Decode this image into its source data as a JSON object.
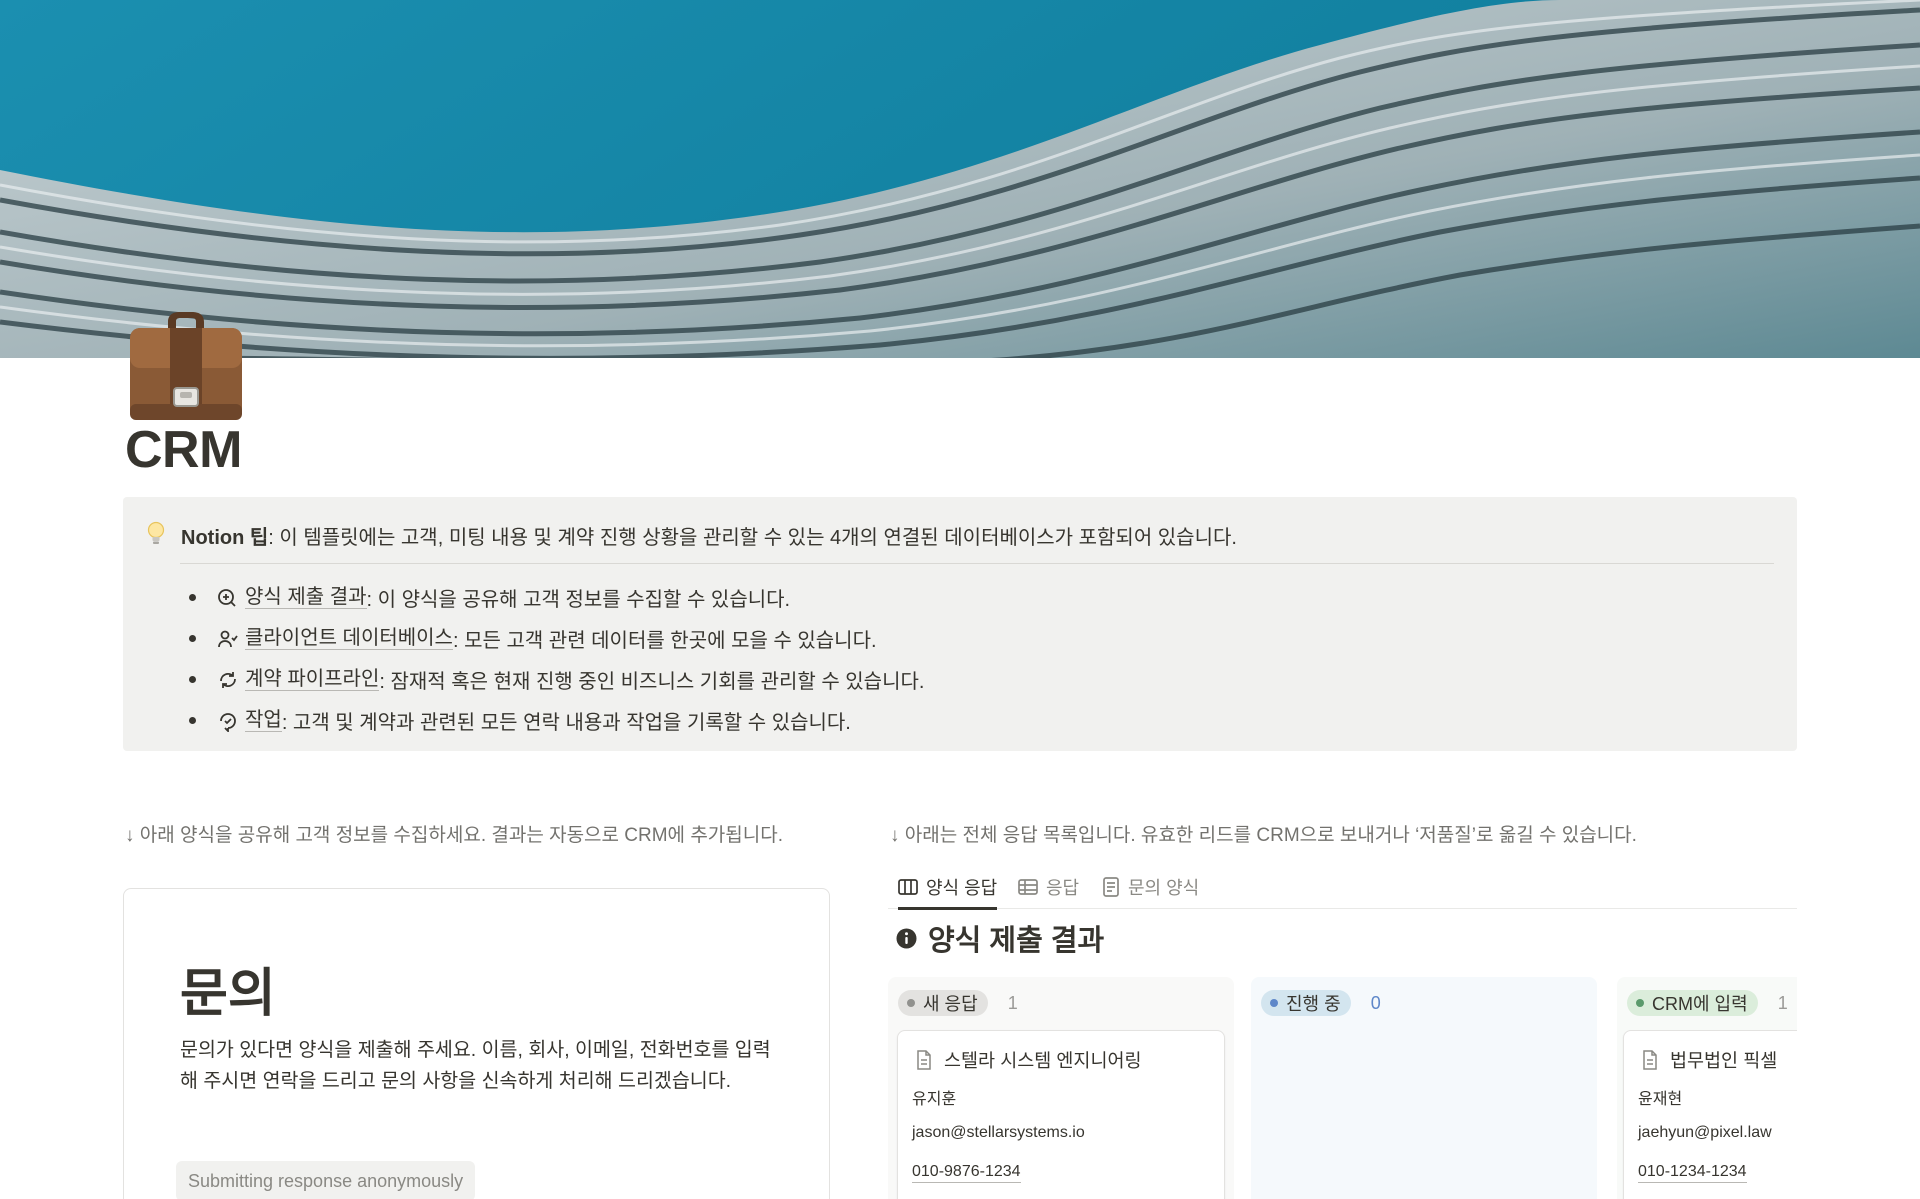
{
  "page": {
    "title": "CRM",
    "cover": "building-facade-cover-image",
    "icon": "briefcase-icon"
  },
  "callout": {
    "icon": "lightbulb-icon",
    "tip_bold": "Notion 팁",
    "tip_text": ": 이 템플릿에는 고객, 미팅 내용 및 계약 진행 상황을 관리할 수 있는 4개의 연결된 데이터베이스가 포함되어 있습니다.",
    "items": [
      {
        "icon": "form-submit-icon",
        "link": "양식 제출 결과",
        "text": ": 이 양식을 공유해 고객 정보를 수집할 수 있습니다."
      },
      {
        "icon": "client-icon",
        "link": "클라이언트 데이터베이스",
        "text": ": 모든 고객 관련 데이터를 한곳에 모을 수 있습니다."
      },
      {
        "icon": "pipeline-icon",
        "link": "계약 파이프라인",
        "text": ": 잠재적 혹은 현재 진행 중인 비즈니스 기회를 관리할 수 있습니다."
      },
      {
        "icon": "task-icon",
        "link": "작업",
        "text": ": 고객 및 계약과 관련된 모든 연락 내용과 작업을 기록할 수 있습니다."
      }
    ]
  },
  "left": {
    "description": "↓ 아래 양식을 공유해 고객 정보를 수집하세요. 결과는 자동으로 CRM에 추가됩니다.",
    "form": {
      "title": "문의",
      "description": "문의가 있다면 양식을 제출해 주세요. 이름, 회사, 이메일, 전화번호를 입력해 주시면 연락을 드리고 문의 사항을 신속하게 처리해 드리겠습니다.",
      "anonymous_note": "Submitting response anonymously"
    }
  },
  "right": {
    "description": "↓ 아래는 전체 응답 목록입니다. 유효한 리드를 CRM으로 보내거나 ‘저품질’로 옮길 수 있습니다.",
    "tabs": [
      {
        "label": "양식 응답",
        "icon": "board-icon",
        "active": true
      },
      {
        "label": "응답",
        "icon": "table-icon",
        "active": false
      },
      {
        "label": "문의 양식",
        "icon": "form-icon",
        "active": false
      }
    ],
    "board_title": "양식 제출 결과",
    "board_title_icon": "info-icon",
    "columns": [
      {
        "label": "새 응답",
        "count": "1",
        "bg": "#f9f9f8",
        "pill_bg": "#e3e2e0",
        "dot": "#91918e",
        "cards": [
          {
            "title": "스텔라 시스템 엔지니어링",
            "name": "유지훈",
            "email": "jason@stellarsystems.io",
            "phone": "010-9876-1234"
          }
        ]
      },
      {
        "label": "진행 중",
        "count": "0",
        "bg": "#f5f9fc",
        "pill_bg": "#d3e5ef",
        "dot": "#5e87c9",
        "cards": []
      },
      {
        "label": "CRM에 입력",
        "count": "1",
        "bg": "#f8faf8",
        "pill_bg": "#dbeddb",
        "dot": "#5b9a6c",
        "cards": [
          {
            "title": "법무법인 픽셀",
            "name": "윤재현",
            "email": "jaehyun@pixel.law",
            "phone": "010-1234-1234"
          }
        ]
      }
    ]
  }
}
